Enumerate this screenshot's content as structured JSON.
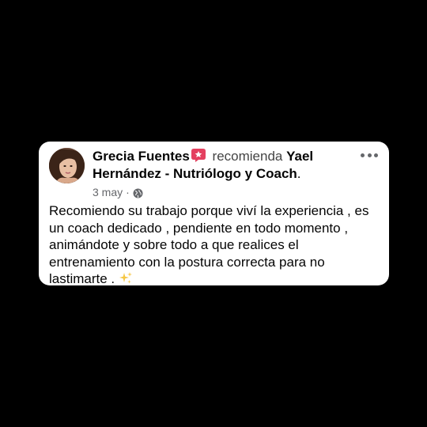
{
  "post": {
    "author": "Grecia Fuentes",
    "recommends_text": " recomienda ",
    "target": "Yael Hernández - Nutriólogo y Coach",
    "target_suffix": ".",
    "date": "3 may",
    "separator": "·",
    "text": "Recomiendo su trabajo porque viví la experiencia , es un coach dedicado , pendiente en todo momento , animándote y sobre todo a que realices el entrenamiento con la postura correcta para no lastimarte . ",
    "audience_icon": "globe-icon",
    "badge_icon": "recommend-badge-icon",
    "menu_icon": "more-options-icon",
    "emoji": "sparkles-icon"
  },
  "colors": {
    "background": "#000000",
    "card": "#ffffff",
    "badge": "#e4405f",
    "meta": "#65676b"
  }
}
